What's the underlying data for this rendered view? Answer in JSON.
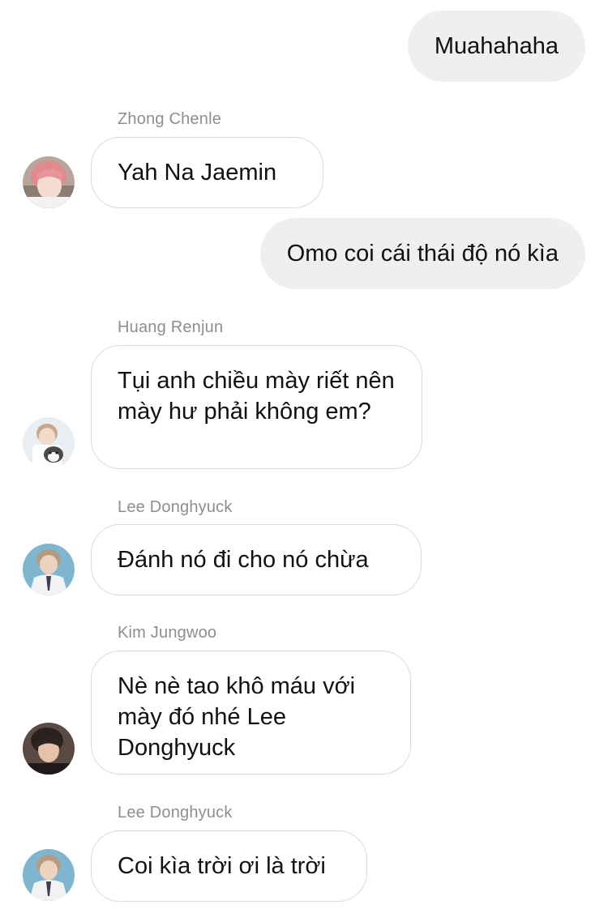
{
  "messages": [
    {
      "type": "sent",
      "text": "Muahahaha"
    },
    {
      "type": "received",
      "sender": "Zhong Chenle",
      "text": "Yah Na Jaemin",
      "avatar": "avatar-pink-hair"
    },
    {
      "type": "sent",
      "text": "Omo coi cái thái độ nó kìa"
    },
    {
      "type": "received",
      "sender": "Huang Renjun",
      "text": "Tụi anh chiều mày riết nên mày hư phải không em?",
      "avatar": "avatar-with-dog"
    },
    {
      "type": "received",
      "sender": "Lee Donghyuck",
      "text": "Đánh nó đi cho nó chừa",
      "avatar": "avatar-suit"
    },
    {
      "type": "received",
      "sender": "Kim Jungwoo",
      "text": "Nè nè tao khô máu với mày đó nhé Lee Donghyuck",
      "avatar": "avatar-dark"
    },
    {
      "type": "received",
      "sender": "Lee Donghyuck",
      "text": "Coi kìa trời ơi là trời",
      "avatar": "avatar-suit"
    }
  ],
  "colors": {
    "sent_bubble": "#efefef",
    "received_border": "#dbdbdb",
    "sender_name": "#8e8e8e"
  }
}
